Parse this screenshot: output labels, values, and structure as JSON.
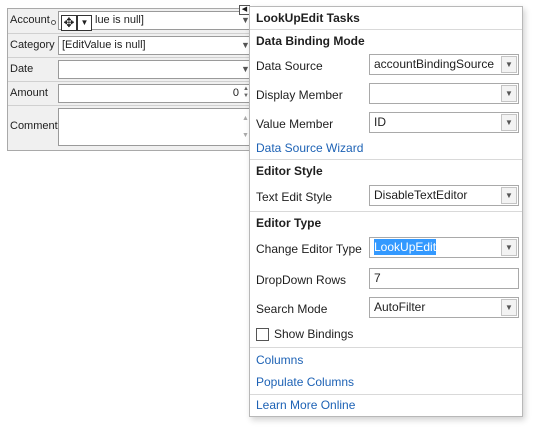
{
  "form": {
    "fields": [
      {
        "label": "Account",
        "value": "[EditValue is null]"
      },
      {
        "label": "Category",
        "value": "[EditValue is null]"
      },
      {
        "label": "Date",
        "value": ""
      },
      {
        "label": "Amount",
        "value": "0"
      },
      {
        "label": "Comment",
        "value": ""
      }
    ],
    "account_visible_tail": "lue is null]"
  },
  "panel": {
    "title": "LookUpEdit Tasks",
    "sections": {
      "data_binding": "Data Binding Mode",
      "editor_style": "Editor Style",
      "editor_type": "Editor Type"
    },
    "data_source": {
      "label": "Data Source",
      "value": "accountBindingSource"
    },
    "display_member": {
      "label": "Display Member",
      "value": ""
    },
    "value_member": {
      "label": "Value Member",
      "value": "ID"
    },
    "wizard_link": "Data Source Wizard",
    "text_edit_style": {
      "label": "Text Edit Style",
      "value": "DisableTextEditor"
    },
    "change_editor_type": {
      "label": "Change Editor Type",
      "value": "LookUpEdit"
    },
    "dropdown_rows": {
      "label": "DropDown Rows",
      "value": "7"
    },
    "search_mode": {
      "label": "Search Mode",
      "value": "AutoFilter"
    },
    "show_bindings": {
      "label": "Show Bindings",
      "checked": false
    },
    "links": [
      "Columns",
      "Populate Columns",
      "Learn More Online"
    ]
  },
  "icons": {
    "dropdown": "chevron-down-icon",
    "move": "move-cross-icon",
    "smart_tag": "smart-tag-arrow-icon"
  },
  "colors": {
    "link": "#1d62b5",
    "selection": "#3399ff"
  }
}
